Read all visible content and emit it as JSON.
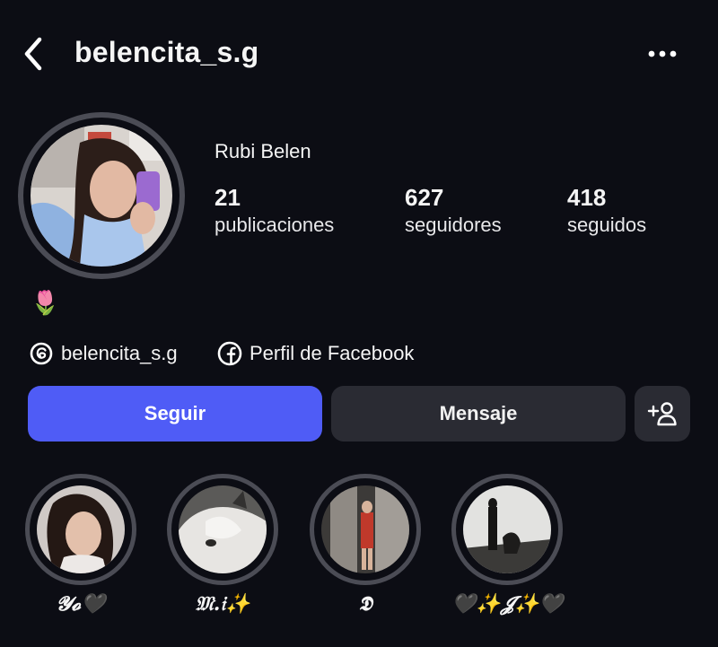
{
  "header": {
    "username": "belencita_s.g",
    "back_icon": "chevron-left-icon",
    "more_icon": "more-horizontal-icon"
  },
  "profile": {
    "full_name": "Rubi Belen",
    "stats": [
      {
        "value": "21",
        "label": "publicaciones"
      },
      {
        "value": "627",
        "label": "seguidores"
      },
      {
        "value": "418",
        "label": "seguidos"
      }
    ],
    "bio_emoji": "🌷"
  },
  "links": {
    "threads": {
      "icon": "threads-icon",
      "label": "belencita_s.g"
    },
    "facebook": {
      "icon": "facebook-icon",
      "label": "Perfil de Facebook"
    }
  },
  "actions": {
    "follow_label": "Seguir",
    "message_label": "Mensaje",
    "add_person_icon": "add-person-icon"
  },
  "colors": {
    "background": "#0c0d14",
    "accent": "#4f5cf6",
    "button_secondary": "#2a2b33",
    "ring": "#4b4c55"
  },
  "highlights": [
    {
      "label": "𝓨𝓸🖤"
    },
    {
      "label": "𝔐.𝔦✨"
    },
    {
      "label": "𝕯"
    },
    {
      "label": "🖤✨𝓙✨🖤"
    }
  ]
}
